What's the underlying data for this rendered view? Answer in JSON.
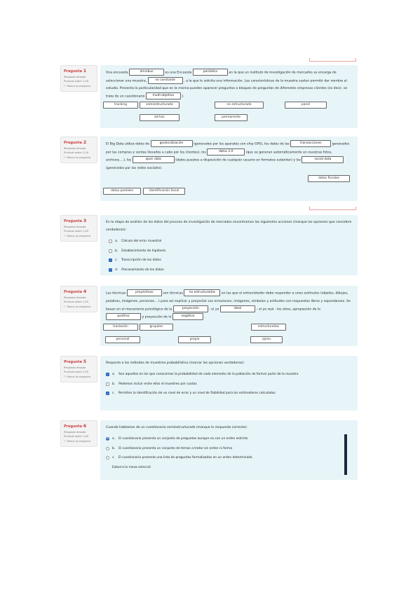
{
  "common": {
    "status": "Resposta desada",
    "score": "Puntuat sobre 1,00",
    "flag": "Marca la pregunta",
    "q_prefix": "Pregunta"
  },
  "q1": {
    "num": "1",
    "t1": "Una encuesta",
    "g1": "ómnibus",
    "t2": "es una Encuesta",
    "g2": "periódica",
    "t3": "en la que un instituto de investigación de mercados se encarga de seleccionar una muestra,",
    "g3": "no constante",
    "t4": ", a la que le solicita una información. Las características de la muestra suelen permitir dar nombre al estudio. Presenta la particularidad que en la misma pueden aparecer preguntas o bloques de preguntas de diferentes empresas clientes (es decir, se trata de un cuestionario",
    "g4": "multi-objetivo",
    "t5": ").",
    "chips": [
      "tracking",
      "semiestructurado",
      "no estructurado",
      "panel",
      "ad-hoc",
      "permanente"
    ]
  },
  "q2": {
    "num": "2",
    "t1": "El Big Data utiliza datos de",
    "g1": "geolocalización",
    "t2": "(generados por los aparatos con chip GPS), los datos de las",
    "g2": "transacciones",
    "t3": "generados por las compras y ventas llevados a cabo por los clientes), los",
    "g3": "datos 2.0",
    "t4": "(que se generan automáticamente en nuestras fotos, archivos....), los",
    "g4": "open data",
    "t5": "(datos puestos a disposición de cualquier usuario en formatos estándar) y los",
    "g5": "social data",
    "t6": "(generados por las redes sociales).",
    "chips": [
      "datos fiscales",
      "datos postales",
      "identificación facial"
    ]
  },
  "q3": {
    "num": "3",
    "text": "En la etapa de análisis de los datos del proceso de investigación de mercados encontramos las siguientes acciones (marque las opciones que considere verdaderas):",
    "options": [
      {
        "letter": "a.",
        "text": "Cálculo del error muestral",
        "checked": false
      },
      {
        "letter": "b.",
        "text": "Establecimiento de hipótesis",
        "checked": false
      },
      {
        "letter": "c.",
        "text": "Transcripción de los datos",
        "checked": true
      },
      {
        "letter": "d.",
        "text": "Procesamiento de los datos",
        "checked": true
      }
    ]
  },
  "q4": {
    "num": "4",
    "t1": "Las técnicas",
    "g1": "proyectivas",
    "t2": "son técnicas",
    "g2": "no estructuradas",
    "t3": "en las que el entrevistador debe responder a unos estímulos (objetos, dibujos, palabras, imágenes, personas....) para así explicar y proyectar sus emociones, imágenes, símbolos y actitudes con respuestas libres y espontáneas. Se basan en el mecanismo psicológico de la",
    "g3": "proyección",
    "t4": ": el yo",
    "g4": "ideal",
    "t5": "– el yo real - los otros, apropiación de lo",
    "g5": "positivo",
    "t6": "y proyección de lo",
    "g6": "negativo",
    "t7": ".",
    "chips": [
      "traslación",
      "grupales",
      "estructuradas",
      "personal",
      "propio",
      "ajeno"
    ]
  },
  "q5": {
    "num": "5",
    "text": "Respecto a los métodos de muestreo probabilístico (marcar las opciones verdaderas):",
    "options": [
      {
        "letter": "a.",
        "text": "Son aquellos en los que conocemos la probabilidad de cada elemento de la población de formar parte de la muestra",
        "checked": true
      },
      {
        "letter": "b.",
        "text": "Podemos incluir entre ellos el muestreo por cuotas",
        "checked": false
      },
      {
        "letter": "c.",
        "text": "Permiten la identificación de un nivel de error y un nivel de fiabilidad para los estimadores calculados.",
        "checked": true
      }
    ]
  },
  "q6": {
    "num": "6",
    "text": "Cuando hablamos de un cuestionario semiestructurado (marque la respuesta correcta):",
    "options": [
      {
        "letter": "a.",
        "text": "El cuestionario presenta un conjunto de preguntas aunque no con un orden estricto",
        "checked": true
      },
      {
        "letter": "b.",
        "text": "El cuestionario presenta un conjunto de temas a tratar sin orden ni forma",
        "checked": false
      },
      {
        "letter": "c.",
        "text": "El cuestionario presenta una lista de preguntas formalizadas en un orden determinado",
        "checked": false
      }
    ],
    "clear": "Esborra la meva selecció"
  }
}
